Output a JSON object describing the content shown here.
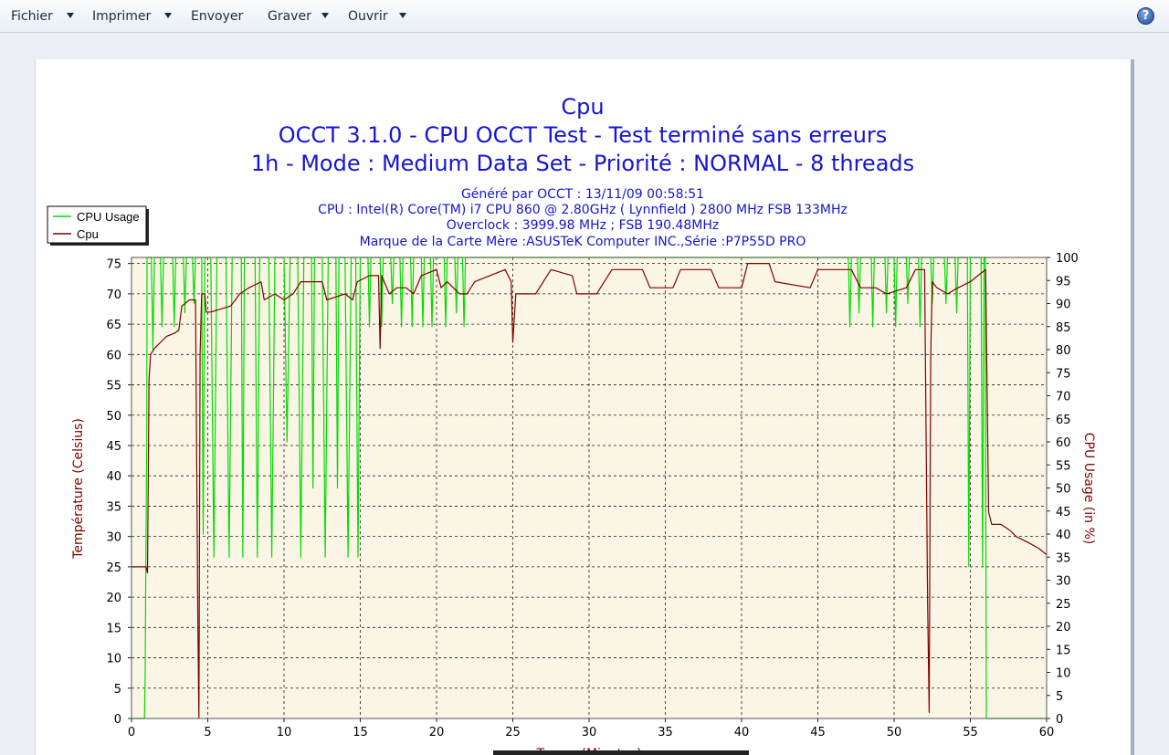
{
  "toolbar": {
    "items": [
      {
        "label": "Fichier",
        "has_dropdown": true
      },
      {
        "label": "Imprimer",
        "has_dropdown": true
      },
      {
        "label": "Envoyer",
        "has_dropdown": false
      },
      {
        "label": "Graver",
        "has_dropdown": true
      },
      {
        "label": "Ouvrir",
        "has_dropdown": true
      }
    ],
    "help_icon": "help-icon",
    "help_glyph": "?"
  },
  "chart_data": {
    "type": "line",
    "title": "Cpu",
    "subtitle_lines": [
      "OCCT 3.1.0 - CPU OCCT Test - Test terminé sans erreurs",
      "1h - Mode : Medium Data Set - Priorité : NORMAL - 8 threads"
    ],
    "info_lines": [
      "Généré par OCCT : 13/11/09 00:58:51",
      "CPU : Intel(R) Core(TM) i7 CPU 860 @ 2.80GHz ( Lynnfield ) 2800 MHz FSB 133MHz",
      "Overclock : 3999.98 MHz ; FSB 190.48MHz",
      "Marque de la Carte Mère :ASUSTeK Computer INC.,Série :P7P55D PRO"
    ],
    "xlabel": "Temps (Minutes)",
    "ylabel": "Température (Celsius)",
    "y2label": "CPU Usage (in %)",
    "xlim": [
      0,
      60
    ],
    "ylim": [
      0,
      76
    ],
    "y2lim": [
      0,
      100
    ],
    "xticks": [
      0,
      5,
      10,
      15,
      20,
      25,
      30,
      35,
      40,
      45,
      50,
      55,
      60
    ],
    "yticks": [
      0,
      5,
      10,
      15,
      20,
      25,
      30,
      35,
      40,
      45,
      50,
      55,
      60,
      65,
      70,
      75
    ],
    "y2ticks": [
      0,
      5,
      10,
      15,
      20,
      25,
      30,
      35,
      40,
      45,
      50,
      55,
      60,
      65,
      70,
      75,
      80,
      85,
      90,
      95,
      100
    ],
    "grid": true,
    "legend_position": "top-left",
    "colors": {
      "cpu_usage": "#00dd00",
      "cpu_temp": "#800000",
      "plot_bg": "#fbf5e6",
      "text_blue": "#1515d4",
      "axis_label": "#800000"
    },
    "series": [
      {
        "name": "CPU Usage",
        "axis": "right",
        "color": "#00dd00",
        "points": [
          [
            0.0,
            0
          ],
          [
            0.75,
            0
          ],
          [
            0.85,
            0
          ],
          [
            0.9,
            10
          ],
          [
            0.95,
            40
          ],
          [
            1.0,
            60
          ],
          [
            1.02,
            100
          ],
          [
            1.3,
            100
          ],
          [
            1.4,
            80
          ],
          [
            1.5,
            100
          ],
          [
            1.9,
            100
          ],
          [
            2.0,
            85
          ],
          [
            2.1,
            100
          ],
          [
            2.7,
            100
          ],
          [
            2.8,
            85
          ],
          [
            2.9,
            100
          ],
          [
            3.4,
            100
          ],
          [
            3.5,
            88
          ],
          [
            3.6,
            100
          ],
          [
            4.0,
            100
          ],
          [
            4.1,
            90
          ],
          [
            4.2,
            100
          ],
          [
            4.6,
            100
          ],
          [
            4.7,
            40
          ],
          [
            4.8,
            100
          ],
          [
            5.2,
            100
          ],
          [
            5.4,
            35
          ],
          [
            5.6,
            100
          ],
          [
            6.2,
            100
          ],
          [
            6.4,
            35
          ],
          [
            6.6,
            100
          ],
          [
            7.2,
            100
          ],
          [
            7.3,
            35
          ],
          [
            7.4,
            100
          ],
          [
            8.1,
            100
          ],
          [
            8.25,
            35
          ],
          [
            8.4,
            100
          ],
          [
            9.0,
            100
          ],
          [
            9.2,
            35
          ],
          [
            9.4,
            100
          ],
          [
            10.0,
            100
          ],
          [
            10.2,
            60
          ],
          [
            10.4,
            100
          ],
          [
            10.9,
            100
          ],
          [
            11.1,
            35
          ],
          [
            11.3,
            100
          ],
          [
            11.8,
            100
          ],
          [
            11.9,
            50
          ],
          [
            12.0,
            100
          ],
          [
            12.5,
            100
          ],
          [
            12.7,
            35
          ],
          [
            12.9,
            100
          ],
          [
            13.4,
            100
          ],
          [
            13.5,
            50
          ],
          [
            13.6,
            100
          ],
          [
            14.0,
            100
          ],
          [
            14.2,
            35
          ],
          [
            14.4,
            100
          ],
          [
            14.7,
            100
          ],
          [
            14.85,
            35
          ],
          [
            15.0,
            100
          ],
          [
            15.5,
            100
          ],
          [
            15.6,
            85
          ],
          [
            15.7,
            100
          ],
          [
            16.3,
            100
          ],
          [
            16.4,
            85
          ],
          [
            16.5,
            100
          ],
          [
            17.0,
            100
          ],
          [
            17.1,
            90
          ],
          [
            17.2,
            100
          ],
          [
            17.6,
            100
          ],
          [
            17.7,
            85
          ],
          [
            17.8,
            100
          ],
          [
            18.3,
            100
          ],
          [
            18.4,
            85
          ],
          [
            18.5,
            100
          ],
          [
            19.0,
            100
          ],
          [
            19.1,
            85
          ],
          [
            19.2,
            100
          ],
          [
            19.6,
            100
          ],
          [
            19.7,
            85
          ],
          [
            19.8,
            100
          ],
          [
            20.5,
            100
          ],
          [
            20.6,
            85
          ],
          [
            20.7,
            100
          ],
          [
            21.2,
            100
          ],
          [
            21.3,
            88
          ],
          [
            21.4,
            100
          ],
          [
            21.7,
            100
          ],
          [
            21.8,
            85
          ],
          [
            21.9,
            100
          ],
          [
            47.0,
            100
          ],
          [
            47.1,
            85
          ],
          [
            47.2,
            100
          ],
          [
            47.6,
            100
          ],
          [
            47.7,
            88
          ],
          [
            47.8,
            100
          ],
          [
            48.5,
            100
          ],
          [
            48.6,
            85
          ],
          [
            48.7,
            100
          ],
          [
            49.4,
            100
          ],
          [
            49.5,
            88
          ],
          [
            49.6,
            100
          ],
          [
            50.0,
            100
          ],
          [
            50.1,
            85
          ],
          [
            50.2,
            100
          ],
          [
            50.8,
            100
          ],
          [
            50.9,
            90
          ],
          [
            51.0,
            100
          ],
          [
            51.6,
            100
          ],
          [
            51.7,
            85
          ],
          [
            51.8,
            100
          ],
          [
            52.4,
            100
          ],
          [
            52.5,
            90
          ],
          [
            52.6,
            100
          ],
          [
            53.3,
            100
          ],
          [
            53.4,
            90
          ],
          [
            53.5,
            100
          ],
          [
            54.0,
            100
          ],
          [
            54.1,
            88
          ],
          [
            54.2,
            100
          ],
          [
            54.8,
            100
          ],
          [
            54.9,
            33
          ],
          [
            55.0,
            100
          ],
          [
            55.7,
            100
          ],
          [
            55.8,
            33
          ],
          [
            55.9,
            100
          ],
          [
            55.98,
            100
          ],
          [
            56.0,
            60
          ],
          [
            56.05,
            0
          ],
          [
            56.2,
            0
          ],
          [
            60.0,
            0
          ]
        ]
      },
      {
        "name": "Cpu",
        "axis": "left",
        "color": "#800000",
        "points": [
          [
            0.0,
            25
          ],
          [
            0.95,
            25
          ],
          [
            1.05,
            24
          ],
          [
            1.15,
            56
          ],
          [
            1.25,
            60
          ],
          [
            1.5,
            61
          ],
          [
            1.9,
            62
          ],
          [
            2.3,
            63
          ],
          [
            2.8,
            63.5
          ],
          [
            3.1,
            64
          ],
          [
            3.3,
            68
          ],
          [
            3.8,
            69
          ],
          [
            4.2,
            69
          ],
          [
            4.35,
            17
          ],
          [
            4.42,
            0
          ],
          [
            4.5,
            60
          ],
          [
            4.6,
            70
          ],
          [
            4.8,
            70
          ],
          [
            4.9,
            67
          ],
          [
            5.2,
            67
          ],
          [
            6.5,
            68
          ],
          [
            7.1,
            70
          ],
          [
            7.7,
            71
          ],
          [
            8.5,
            72
          ],
          [
            8.7,
            69
          ],
          [
            9.4,
            70
          ],
          [
            10.0,
            69
          ],
          [
            10.6,
            70
          ],
          [
            11.1,
            72
          ],
          [
            12.5,
            72
          ],
          [
            12.8,
            69
          ],
          [
            14.0,
            70
          ],
          [
            14.5,
            69
          ],
          [
            14.8,
            72
          ],
          [
            15.6,
            73
          ],
          [
            16.2,
            73
          ],
          [
            16.3,
            61
          ],
          [
            16.4,
            73
          ],
          [
            16.9,
            70
          ],
          [
            17.4,
            71
          ],
          [
            18.0,
            71
          ],
          [
            18.5,
            70
          ],
          [
            19.0,
            73
          ],
          [
            20.0,
            74
          ],
          [
            20.3,
            71
          ],
          [
            20.7,
            72
          ],
          [
            21.5,
            70
          ],
          [
            22.0,
            70
          ],
          [
            22.5,
            72
          ],
          [
            24.5,
            74
          ],
          [
            24.9,
            72
          ],
          [
            25.0,
            62
          ],
          [
            25.2,
            70
          ],
          [
            26.5,
            70
          ],
          [
            27.5,
            74
          ],
          [
            28.9,
            73
          ],
          [
            29.2,
            70
          ],
          [
            30.5,
            70
          ],
          [
            31.5,
            74
          ],
          [
            33.5,
            74
          ],
          [
            34.0,
            71
          ],
          [
            35.5,
            71
          ],
          [
            36.0,
            74
          ],
          [
            38.0,
            74
          ],
          [
            38.5,
            71
          ],
          [
            40.0,
            71
          ],
          [
            40.4,
            75
          ],
          [
            41.8,
            75
          ],
          [
            42.2,
            72
          ],
          [
            44.5,
            71
          ],
          [
            45.0,
            74
          ],
          [
            46.5,
            74
          ],
          [
            47.2,
            74
          ],
          [
            47.8,
            71
          ],
          [
            48.8,
            71
          ],
          [
            49.5,
            70
          ],
          [
            50.8,
            71
          ],
          [
            51.4,
            74
          ],
          [
            52.0,
            74
          ],
          [
            52.2,
            19
          ],
          [
            52.3,
            1
          ],
          [
            52.4,
            60
          ],
          [
            52.5,
            72
          ],
          [
            52.8,
            71
          ],
          [
            53.5,
            70
          ],
          [
            54.2,
            71
          ],
          [
            55.0,
            72
          ],
          [
            55.5,
            73
          ],
          [
            56.0,
            74
          ],
          [
            56.2,
            34
          ],
          [
            56.4,
            32
          ],
          [
            57.0,
            32
          ],
          [
            57.6,
            31
          ],
          [
            58.0,
            30
          ],
          [
            58.8,
            29
          ],
          [
            59.5,
            28
          ],
          [
            60.0,
            27
          ]
        ]
      }
    ]
  }
}
